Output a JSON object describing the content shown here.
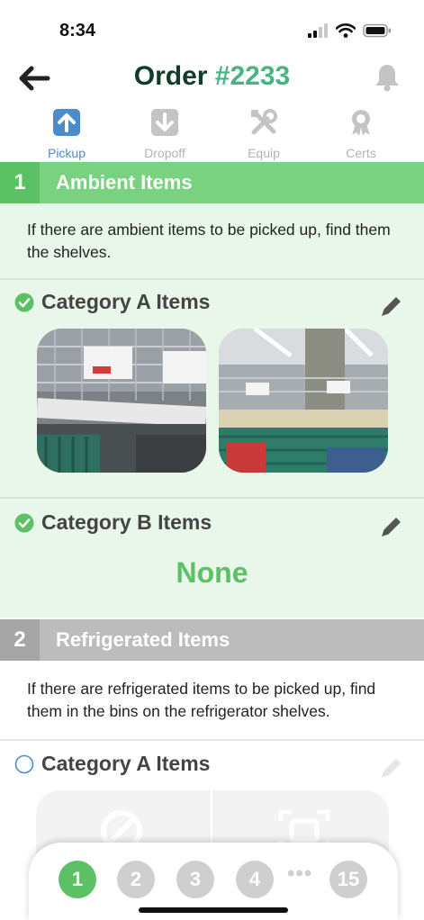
{
  "status_bar": {
    "time": "8:34"
  },
  "header": {
    "title_prefix": "Order ",
    "title_number": "#2233"
  },
  "tabs": [
    {
      "label": "Pickup",
      "icon": "upload-arrow-icon",
      "active": true
    },
    {
      "label": "Dropoff",
      "icon": "download-arrow-icon",
      "active": false
    },
    {
      "label": "Equip",
      "icon": "tools-icon",
      "active": false
    },
    {
      "label": "Certs",
      "icon": "certificate-icon",
      "active": false
    }
  ],
  "sections": [
    {
      "number": "1",
      "title": "Ambient Items",
      "description": "If there are ambient items to be picked up, find them the shelves.",
      "categories": [
        {
          "title": "Category A Items",
          "checked": true
        },
        {
          "title": "Category B Items",
          "checked": true,
          "empty_text": "None"
        }
      ]
    },
    {
      "number": "2",
      "title": "Refrigerated Items",
      "description": "If there are refrigerated items to be picked up, find them in the bins on the refrigerator shelves.",
      "categories": [
        {
          "title": "Category A Items",
          "checked": false
        }
      ]
    }
  ],
  "pager": {
    "pages": [
      "1",
      "2",
      "3",
      "4"
    ],
    "ellipsis": "•••",
    "last": "15",
    "current": "1"
  },
  "colors": {
    "accent_green": "#5cc164",
    "header_green": "#79d27f",
    "title_dark": "#0f3d2a",
    "title_number": "#47b582",
    "tab_active": "#4a8ccc"
  }
}
